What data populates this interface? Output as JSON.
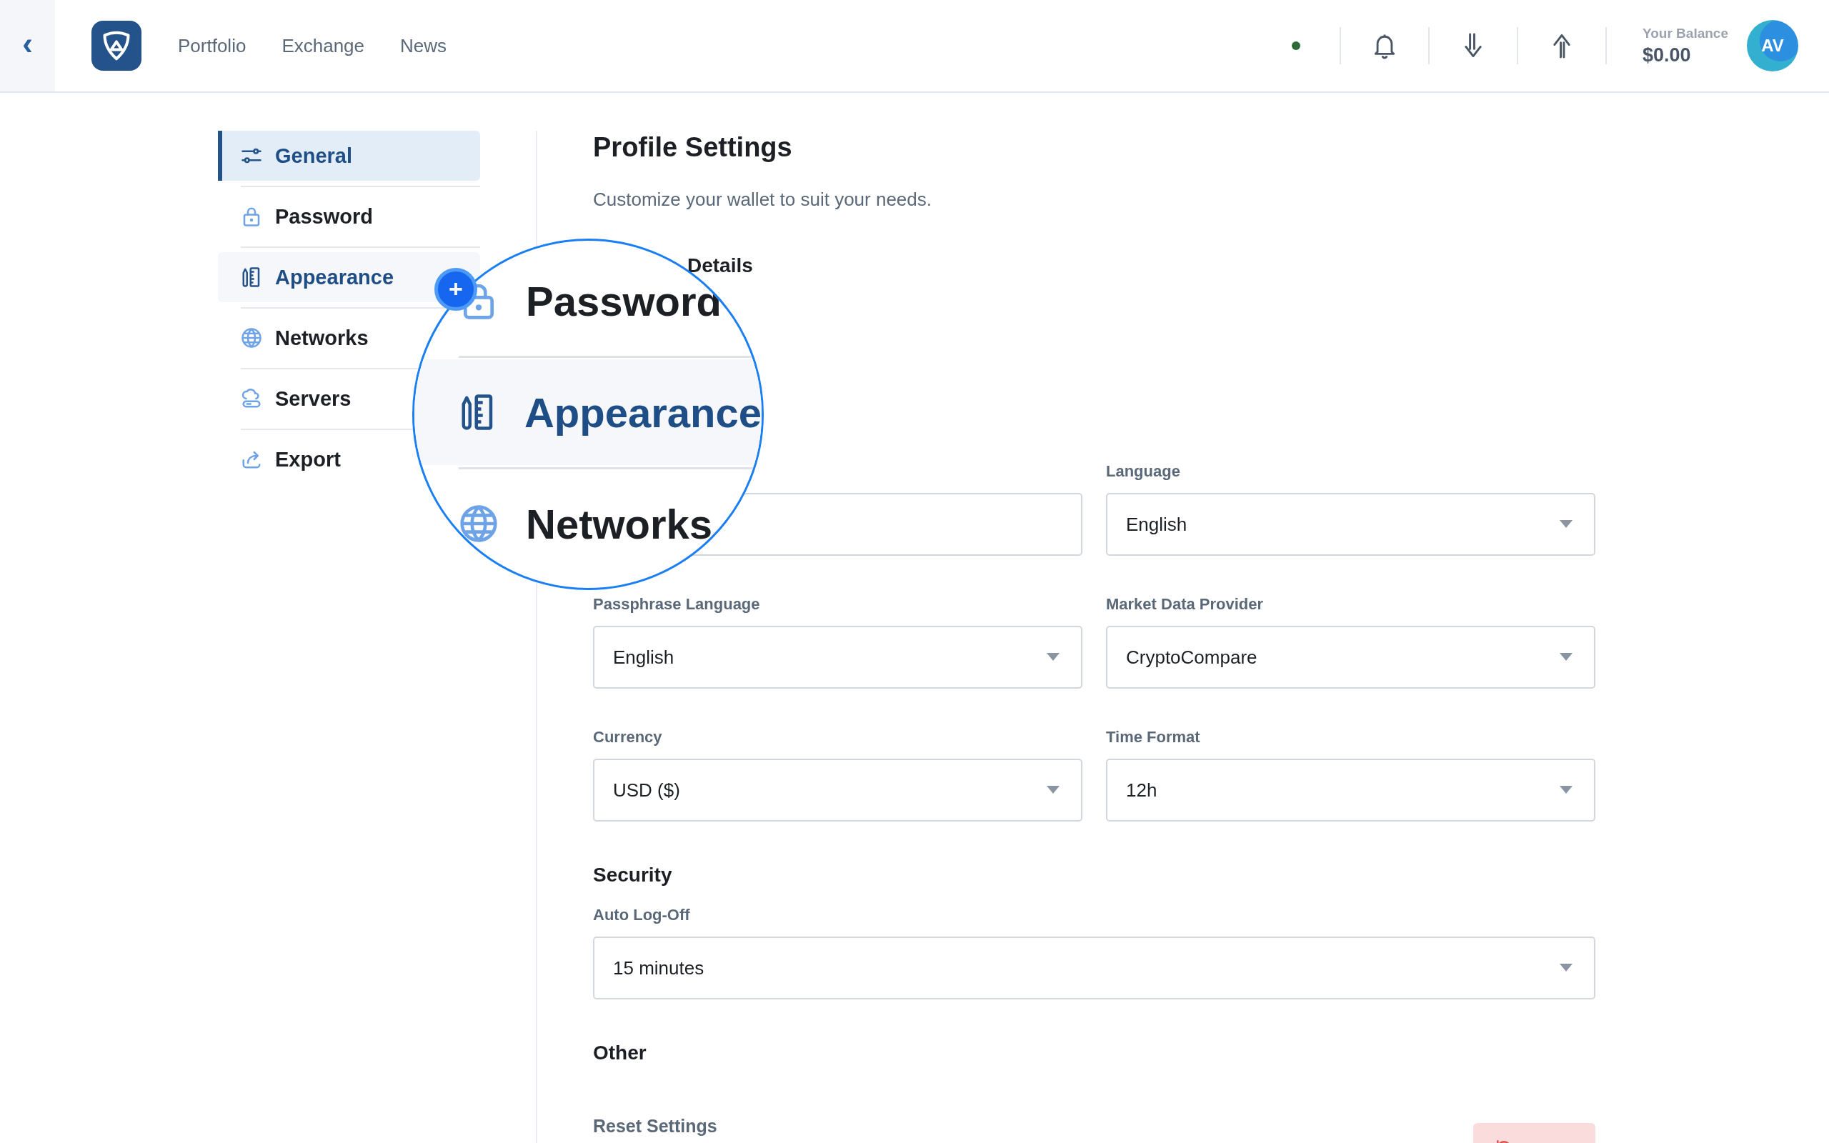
{
  "header": {
    "back": "‹",
    "nav": [
      {
        "label": "Portfolio"
      },
      {
        "label": "Exchange"
      },
      {
        "label": "News"
      }
    ],
    "online": true,
    "balance_label": "Your Balance",
    "balance": "$0.00",
    "avatar": "AV"
  },
  "sidebar": {
    "items": [
      {
        "label": "General",
        "selected": true,
        "hovered": false
      },
      {
        "label": "Password",
        "selected": false,
        "hovered": false
      },
      {
        "label": "Appearance",
        "selected": false,
        "hovered": true
      },
      {
        "label": "Networks",
        "selected": false,
        "hovered": false
      },
      {
        "label": "Servers",
        "selected": false,
        "hovered": false
      },
      {
        "label": "Export",
        "selected": false,
        "hovered": false
      }
    ]
  },
  "magnifier": {
    "badge": "+",
    "items": [
      {
        "label": "Password",
        "hovered": false
      },
      {
        "label": "Appearance",
        "hovered": true
      },
      {
        "label": "Networks",
        "hovered": false
      }
    ]
  },
  "content": {
    "title": "Profile Settings",
    "subtitle": "Customize your wallet to suit your needs.",
    "details_heading": "Details",
    "fields": [
      {
        "kind": "input"
      },
      {
        "kind": "select",
        "label": "Language",
        "value": "English"
      },
      {
        "kind": "select",
        "label": "Passphrase Language",
        "value": "English"
      },
      {
        "kind": "select",
        "label": "Market Data Provider",
        "value": "CryptoCompare"
      },
      {
        "kind": "select",
        "label": "Currency",
        "value": "USD ($)"
      },
      {
        "kind": "select",
        "label": "Time Format",
        "value": "12h"
      }
    ],
    "security": {
      "heading": "Security",
      "fields": [
        {
          "kind": "select",
          "label": "Auto Log-Off",
          "value": "15 minutes"
        }
      ]
    },
    "other": {
      "heading": "Other",
      "rows": [
        {
          "label": "Reset Settings"
        }
      ]
    }
  }
}
